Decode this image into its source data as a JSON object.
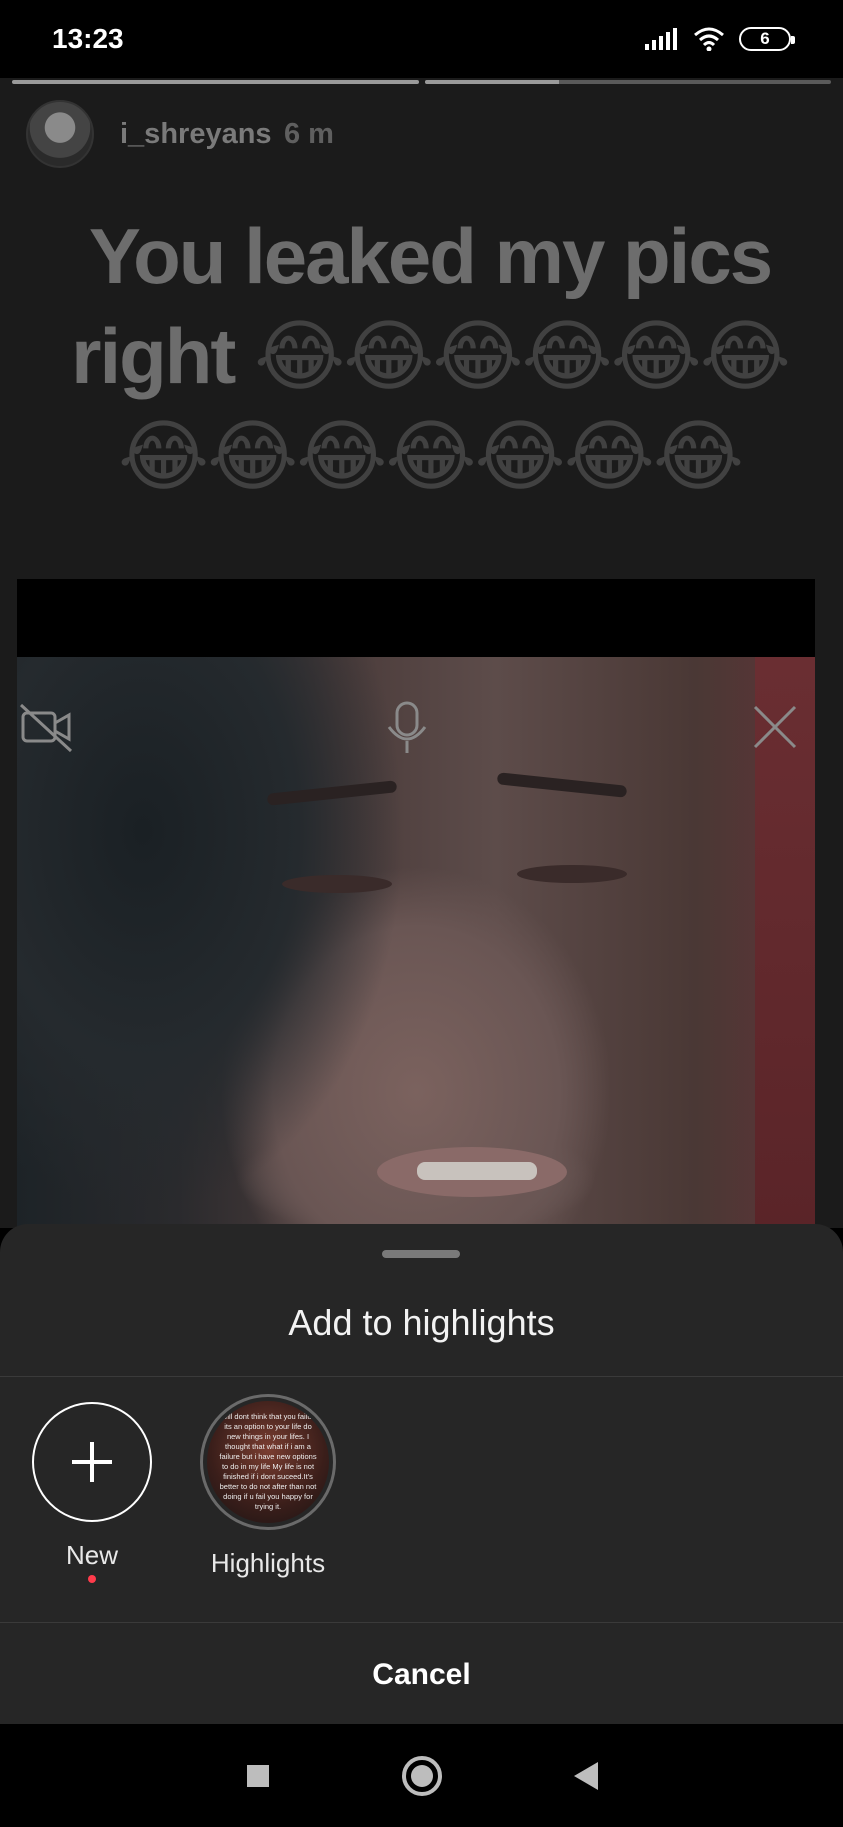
{
  "status_bar": {
    "time": "13:23",
    "battery": "6"
  },
  "story": {
    "username": "i_shreyans",
    "time_ago": "6 m",
    "caption_text": "You leaked my pics right",
    "caption_emojis": "😂😂😂😂😂😂😂😂😂😂😂😂😂",
    "progress": [
      1.0,
      0.33
    ]
  },
  "sheet": {
    "title": "Add to highlights",
    "new_label": "New",
    "highlight_label": "Highlights",
    "highlight_cover_text": "I will dont think that you failure its an option to your life do new things in your lifes. I thought that what if i am a failure but i have new options to do in my life My life is not finished if i dont suceed.It's better to do not after than not doing if u fail you happy for trying it.",
    "cancel_label": "Cancel"
  },
  "colors": {
    "sheet_bg": "#262626",
    "notification_dot": "#ff3b4b"
  }
}
